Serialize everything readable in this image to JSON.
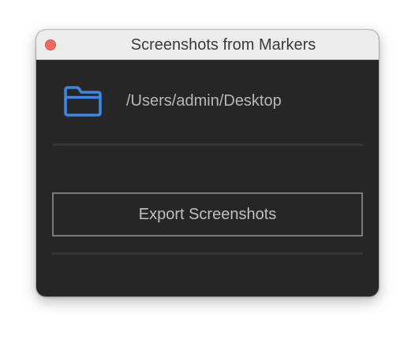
{
  "window": {
    "title": "Screenshots from Markers"
  },
  "folder": {
    "icon": "folder-icon",
    "path": "/Users/admin/Desktop"
  },
  "actions": {
    "export_label": "Export Screenshots"
  },
  "colors": {
    "window_background": "#262626",
    "titlebar_background": "#ececec",
    "close_button": "#ee6a5f",
    "folder_icon": "#3d86e4",
    "button_border": "#7a7a7a",
    "text": "#b8b8b8"
  }
}
